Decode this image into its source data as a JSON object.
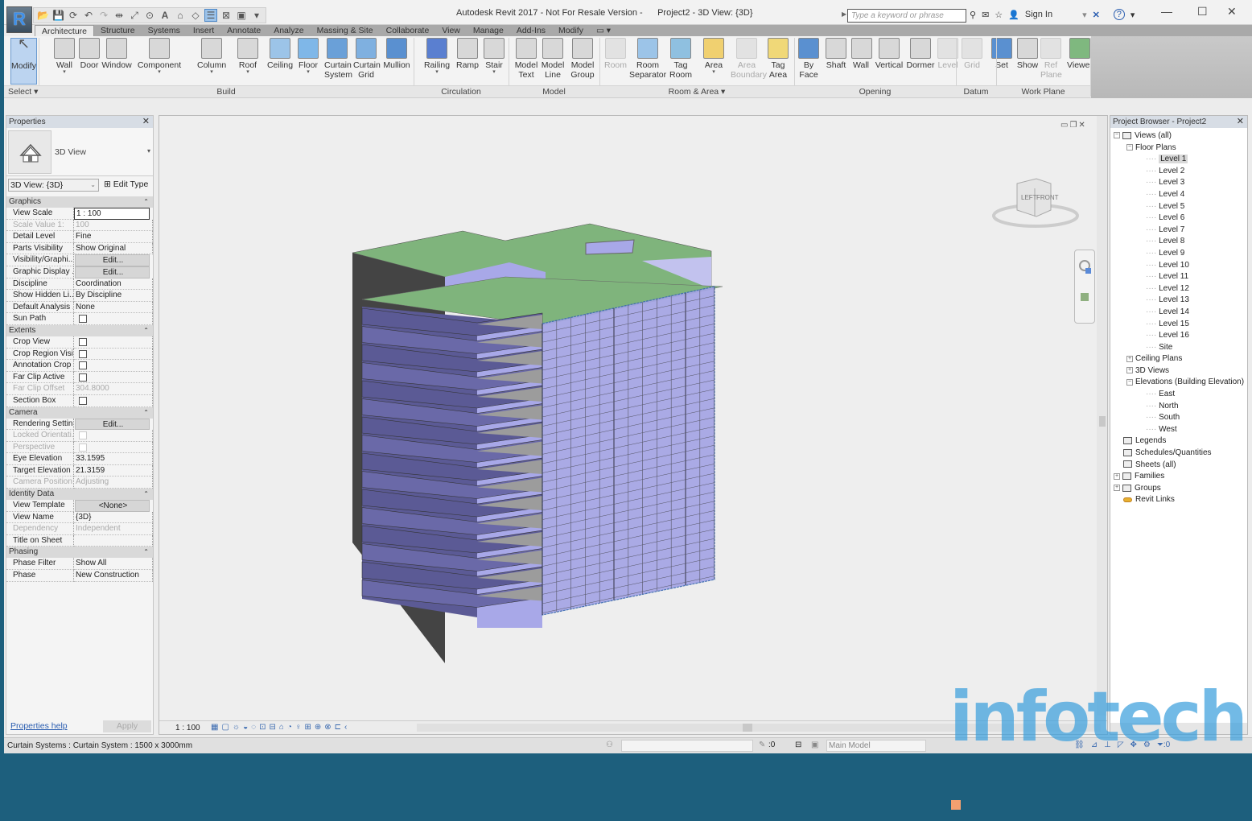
{
  "window": {
    "app_title": "Autodesk Revit 2017 - Not For Resale Version -",
    "doc_title": "Project2 - 3D View: {3D}",
    "app_logo": "R",
    "search_placeholder": "Type a keyword or phrase",
    "sign_in": "Sign In",
    "help": "?",
    "controls": {
      "minimize": "—",
      "maximize": "☐",
      "close": "✕"
    }
  },
  "tabs": [
    {
      "label": "Architecture",
      "active": true
    },
    {
      "label": "Structure"
    },
    {
      "label": "Systems"
    },
    {
      "label": "Insert"
    },
    {
      "label": "Annotate"
    },
    {
      "label": "Analyze"
    },
    {
      "label": "Massing & Site"
    },
    {
      "label": "Collaborate"
    },
    {
      "label": "View"
    },
    {
      "label": "Manage"
    },
    {
      "label": "Add-Ins"
    },
    {
      "label": "Modify"
    },
    {
      "label": "▭ ▾"
    }
  ],
  "ribbon": {
    "panels": [
      {
        "label": "Select ▾"
      },
      {
        "label": "Build"
      },
      {
        "label": "Circulation"
      },
      {
        "label": "Model"
      },
      {
        "label": "Room & Area ▾"
      },
      {
        "label": "Opening"
      },
      {
        "label": "Datum"
      },
      {
        "label": "Work Plane"
      }
    ],
    "buttons": [
      {
        "l1": "Modify",
        "l2": "",
        "icon": "cursor-icon"
      },
      {
        "l1": "Wall",
        "l2": "▾",
        "icon": "wall-icon"
      },
      {
        "l1": "Door",
        "l2": "",
        "icon": "door-icon"
      },
      {
        "l1": "Window",
        "l2": "",
        "icon": "window-icon"
      },
      {
        "l1": "Component",
        "l2": "▾",
        "icon": "component-icon"
      },
      {
        "l1": "Column",
        "l2": "▾",
        "icon": "column-icon"
      },
      {
        "l1": "Roof",
        "l2": "▾",
        "icon": "roof-icon"
      },
      {
        "l1": "Ceiling",
        "l2": "",
        "icon": "ceiling-icon"
      },
      {
        "l1": "Floor",
        "l2": "▾",
        "icon": "floor-icon"
      },
      {
        "l1": "Curtain",
        "l2": "System",
        "icon": "curtain-system-icon"
      },
      {
        "l1": "Curtain",
        "l2": "Grid",
        "icon": "curtain-grid-icon"
      },
      {
        "l1": "Mullion",
        "l2": "",
        "icon": "mullion-icon"
      },
      {
        "l1": "Railing",
        "l2": "▾",
        "icon": "railing-icon"
      },
      {
        "l1": "Ramp",
        "l2": "",
        "icon": "ramp-icon"
      },
      {
        "l1": "Stair",
        "l2": "▾",
        "icon": "stair-icon"
      },
      {
        "l1": "Model",
        "l2": "Text",
        "icon": "model-text-icon"
      },
      {
        "l1": "Model",
        "l2": "Line",
        "icon": "model-line-icon"
      },
      {
        "l1": "Model",
        "l2": "Group",
        "icon": "model-group-icon"
      },
      {
        "l1": "Room",
        "l2": "",
        "icon": "room-icon",
        "disabled": true
      },
      {
        "l1": "Room",
        "l2": "Separator",
        "icon": "room-separator-icon"
      },
      {
        "l1": "Tag",
        "l2": "Room",
        "icon": "tag-room-icon"
      },
      {
        "l1": "Area",
        "l2": "▾",
        "icon": "area-icon"
      },
      {
        "l1": "Area",
        "l2": "Boundary",
        "icon": "area-boundary-icon",
        "disabled": true
      },
      {
        "l1": "Tag",
        "l2": "Area",
        "icon": "tag-area-icon"
      },
      {
        "l1": "By",
        "l2": "Face",
        "icon": "by-face-icon"
      },
      {
        "l1": "Shaft",
        "l2": "",
        "icon": "shaft-icon"
      },
      {
        "l1": "Wall",
        "l2": "",
        "icon": "wall-opening-icon"
      },
      {
        "l1": "Vertical",
        "l2": "",
        "icon": "vertical-icon"
      },
      {
        "l1": "Dormer",
        "l2": "",
        "icon": "dormer-icon"
      },
      {
        "l1": "Level",
        "l2": "",
        "icon": "level-icon",
        "disabled": true
      },
      {
        "l1": "Grid",
        "l2": "",
        "icon": "grid-icon",
        "disabled": true
      },
      {
        "l1": "Set",
        "l2": "",
        "icon": "set-icon"
      },
      {
        "l1": "Show",
        "l2": "",
        "icon": "show-icon"
      },
      {
        "l1": "Ref",
        "l2": "Plane",
        "icon": "ref-plane-icon",
        "disabled": true
      },
      {
        "l1": "Viewer",
        "l2": "",
        "icon": "viewer-icon"
      }
    ]
  },
  "properties": {
    "title": "Properties",
    "type_name": "3D View",
    "instance_selector": "3D View: {3D}",
    "edit_type": "Edit Type",
    "categories": [
      {
        "name": "Graphics",
        "rows": [
          {
            "k": "View Scale",
            "v": "1 : 100",
            "kind": "field"
          },
          {
            "k": "Scale Value    1:",
            "v": "100",
            "dim": true
          },
          {
            "k": "Detail Level",
            "v": "Fine"
          },
          {
            "k": "Parts Visibility",
            "v": "Show Original"
          },
          {
            "k": "Visibility/Graphi...",
            "v": "Edit...",
            "kind": "button"
          },
          {
            "k": "Graphic Display ...",
            "v": "Edit...",
            "kind": "button"
          },
          {
            "k": "Discipline",
            "v": "Coordination"
          },
          {
            "k": "Show Hidden Li...",
            "v": "By Discipline"
          },
          {
            "k": "Default Analysis ...",
            "v": "None"
          },
          {
            "k": "Sun Path",
            "v": "",
            "kind": "checkbox"
          }
        ]
      },
      {
        "name": "Extents",
        "rows": [
          {
            "k": "Crop View",
            "v": "",
            "kind": "checkbox"
          },
          {
            "k": "Crop Region Visi...",
            "v": "",
            "kind": "checkbox"
          },
          {
            "k": "Annotation Crop",
            "v": "",
            "kind": "checkbox"
          },
          {
            "k": "Far Clip Active",
            "v": "",
            "kind": "checkbox"
          },
          {
            "k": "Far Clip Offset",
            "v": "304.8000",
            "dim": true
          },
          {
            "k": "Section Box",
            "v": "",
            "kind": "checkbox"
          }
        ]
      },
      {
        "name": "Camera",
        "rows": [
          {
            "k": "Rendering Settin...",
            "v": "Edit...",
            "kind": "button"
          },
          {
            "k": "Locked Orientati...",
            "v": "",
            "kind": "checkbox",
            "dim": true
          },
          {
            "k": "Perspective",
            "v": "",
            "kind": "checkbox",
            "dim": true
          },
          {
            "k": "Eye Elevation",
            "v": "33.1595"
          },
          {
            "k": "Target Elevation",
            "v": "21.3159"
          },
          {
            "k": "Camera Position",
            "v": "Adjusting",
            "dim": true
          }
        ]
      },
      {
        "name": "Identity Data",
        "rows": [
          {
            "k": "View Template",
            "v": "<None>",
            "kind": "button"
          },
          {
            "k": "View Name",
            "v": "{3D}"
          },
          {
            "k": "Dependency",
            "v": "Independent",
            "dim": true
          },
          {
            "k": "Title on Sheet",
            "v": ""
          }
        ]
      },
      {
        "name": "Phasing",
        "rows": [
          {
            "k": "Phase Filter",
            "v": "Show All"
          },
          {
            "k": "Phase",
            "v": "New Construction"
          }
        ]
      }
    ],
    "help_link": "Properties help",
    "apply": "Apply"
  },
  "view": {
    "scale": "1 : 100",
    "viewcube": {
      "left": "LEFT",
      "front": "FRONT"
    }
  },
  "browser": {
    "title": "Project Browser - Project2",
    "items": [
      {
        "label": "Views (all)",
        "depth": 0,
        "toggle": "−",
        "icon": "views-icon"
      },
      {
        "label": "Floor Plans",
        "depth": 1,
        "toggle": "−"
      },
      {
        "label": "Level 1",
        "depth": 2,
        "selected": true
      },
      {
        "label": "Level 2",
        "depth": 2
      },
      {
        "label": "Level 3",
        "depth": 2
      },
      {
        "label": "Level 4",
        "depth": 2
      },
      {
        "label": "Level 5",
        "depth": 2
      },
      {
        "label": "Level 6",
        "depth": 2
      },
      {
        "label": "Level 7",
        "depth": 2
      },
      {
        "label": "Level 8",
        "depth": 2
      },
      {
        "label": "Level 9",
        "depth": 2
      },
      {
        "label": "Level 10",
        "depth": 2
      },
      {
        "label": "Level 11",
        "depth": 2
      },
      {
        "label": "Level 12",
        "depth": 2
      },
      {
        "label": "Level 13",
        "depth": 2
      },
      {
        "label": "Level 14",
        "depth": 2
      },
      {
        "label": "Level 15",
        "depth": 2
      },
      {
        "label": "Level 16",
        "depth": 2
      },
      {
        "label": "Site",
        "depth": 2
      },
      {
        "label": "Ceiling Plans",
        "depth": 1,
        "toggle": "+"
      },
      {
        "label": "3D Views",
        "depth": 1,
        "toggle": "+"
      },
      {
        "label": "Elevations (Building Elevation)",
        "depth": 1,
        "toggle": "−"
      },
      {
        "label": "East",
        "depth": 2
      },
      {
        "label": "North",
        "depth": 2
      },
      {
        "label": "South",
        "depth": 2
      },
      {
        "label": "West",
        "depth": 2
      },
      {
        "label": "Legends",
        "depth": 0,
        "icon": "legends-icon"
      },
      {
        "label": "Schedules/Quantities",
        "depth": 0,
        "icon": "schedules-icon"
      },
      {
        "label": "Sheets (all)",
        "depth": 0,
        "icon": "sheets-icon"
      },
      {
        "label": "Families",
        "depth": 0,
        "toggle": "+",
        "icon": "families-icon"
      },
      {
        "label": "Groups",
        "depth": 0,
        "toggle": "+",
        "icon": "groups-icon"
      },
      {
        "label": "Revit Links",
        "depth": 0,
        "icon": "revit-links-icon"
      }
    ]
  },
  "status": {
    "text": "Curtain Systems : Curtain System : 1500 x 3000mm",
    "worksets_count": ":0",
    "design_option": "Main Model",
    "filter_count": ":0"
  },
  "watermark": "infotech",
  "colors": {
    "roof": "#7fb47c",
    "facade_light": "#a8a8e8",
    "facade_dark": "#5b5a95",
    "accent": "#2a5db0"
  }
}
